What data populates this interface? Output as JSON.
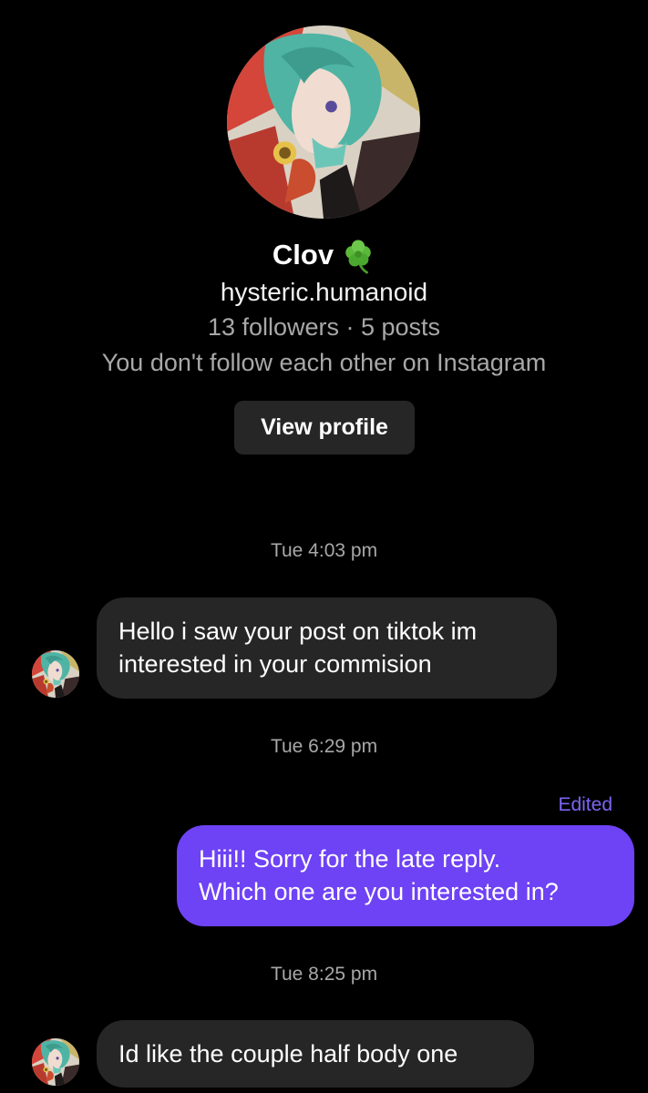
{
  "profile": {
    "display_name": "Clov",
    "name_emoji_icon": "shamrock-icon",
    "handle": "hysteric.humanoid",
    "stats": "13 followers · 5 posts",
    "follow_note": "You don't follow each other on Instagram",
    "view_profile_label": "View profile"
  },
  "messages": {
    "ts1": "Tue 4:03 pm",
    "msg1_line1": "Hello i saw your post on tiktok im",
    "msg1_line2": "interested in your commision",
    "ts2": "Tue 6:29 pm",
    "edited_label": "Edited",
    "msg2_line1": "Hiii!! Sorry for the late reply.",
    "msg2_line2": "Which one are you interested in?",
    "ts3": "Tue 8:25 pm",
    "msg3_line1": "Id like the couple half body one"
  },
  "colors": {
    "background": "#000000",
    "incoming_bubble": "#262626",
    "outgoing_bubble": "#6e42f5",
    "edited_text": "#7d66f2",
    "secondary_text": "#a8a8a8"
  }
}
